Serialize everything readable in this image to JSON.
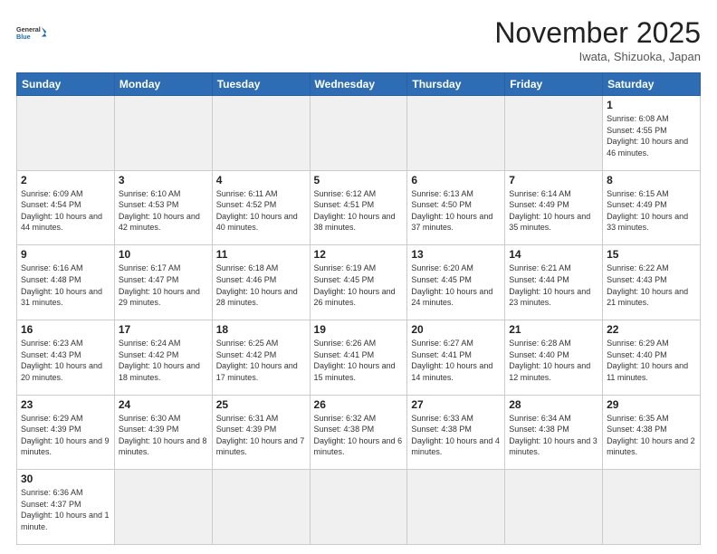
{
  "header": {
    "logo_general": "General",
    "logo_blue": "Blue",
    "month_title": "November 2025",
    "location": "Iwata, Shizuoka, Japan"
  },
  "days_of_week": [
    "Sunday",
    "Monday",
    "Tuesday",
    "Wednesday",
    "Thursday",
    "Friday",
    "Saturday"
  ],
  "weeks": [
    [
      {
        "day": "",
        "empty": true
      },
      {
        "day": "",
        "empty": true
      },
      {
        "day": "",
        "empty": true
      },
      {
        "day": "",
        "empty": true
      },
      {
        "day": "",
        "empty": true
      },
      {
        "day": "",
        "empty": true
      },
      {
        "day": "1",
        "sunrise": "6:08 AM",
        "sunset": "4:55 PM",
        "daylight": "10 hours and 46 minutes."
      }
    ],
    [
      {
        "day": "2",
        "sunrise": "6:09 AM",
        "sunset": "4:54 PM",
        "daylight": "10 hours and 44 minutes."
      },
      {
        "day": "3",
        "sunrise": "6:10 AM",
        "sunset": "4:53 PM",
        "daylight": "10 hours and 42 minutes."
      },
      {
        "day": "4",
        "sunrise": "6:11 AM",
        "sunset": "4:52 PM",
        "daylight": "10 hours and 40 minutes."
      },
      {
        "day": "5",
        "sunrise": "6:12 AM",
        "sunset": "4:51 PM",
        "daylight": "10 hours and 38 minutes."
      },
      {
        "day": "6",
        "sunrise": "6:13 AM",
        "sunset": "4:50 PM",
        "daylight": "10 hours and 37 minutes."
      },
      {
        "day": "7",
        "sunrise": "6:14 AM",
        "sunset": "4:49 PM",
        "daylight": "10 hours and 35 minutes."
      },
      {
        "day": "8",
        "sunrise": "6:15 AM",
        "sunset": "4:49 PM",
        "daylight": "10 hours and 33 minutes."
      }
    ],
    [
      {
        "day": "9",
        "sunrise": "6:16 AM",
        "sunset": "4:48 PM",
        "daylight": "10 hours and 31 minutes."
      },
      {
        "day": "10",
        "sunrise": "6:17 AM",
        "sunset": "4:47 PM",
        "daylight": "10 hours and 29 minutes."
      },
      {
        "day": "11",
        "sunrise": "6:18 AM",
        "sunset": "4:46 PM",
        "daylight": "10 hours and 28 minutes."
      },
      {
        "day": "12",
        "sunrise": "6:19 AM",
        "sunset": "4:45 PM",
        "daylight": "10 hours and 26 minutes."
      },
      {
        "day": "13",
        "sunrise": "6:20 AM",
        "sunset": "4:45 PM",
        "daylight": "10 hours and 24 minutes."
      },
      {
        "day": "14",
        "sunrise": "6:21 AM",
        "sunset": "4:44 PM",
        "daylight": "10 hours and 23 minutes."
      },
      {
        "day": "15",
        "sunrise": "6:22 AM",
        "sunset": "4:43 PM",
        "daylight": "10 hours and 21 minutes."
      }
    ],
    [
      {
        "day": "16",
        "sunrise": "6:23 AM",
        "sunset": "4:43 PM",
        "daylight": "10 hours and 20 minutes."
      },
      {
        "day": "17",
        "sunrise": "6:24 AM",
        "sunset": "4:42 PM",
        "daylight": "10 hours and 18 minutes."
      },
      {
        "day": "18",
        "sunrise": "6:25 AM",
        "sunset": "4:42 PM",
        "daylight": "10 hours and 17 minutes."
      },
      {
        "day": "19",
        "sunrise": "6:26 AM",
        "sunset": "4:41 PM",
        "daylight": "10 hours and 15 minutes."
      },
      {
        "day": "20",
        "sunrise": "6:27 AM",
        "sunset": "4:41 PM",
        "daylight": "10 hours and 14 minutes."
      },
      {
        "day": "21",
        "sunrise": "6:28 AM",
        "sunset": "4:40 PM",
        "daylight": "10 hours and 12 minutes."
      },
      {
        "day": "22",
        "sunrise": "6:29 AM",
        "sunset": "4:40 PM",
        "daylight": "10 hours and 11 minutes."
      }
    ],
    [
      {
        "day": "23",
        "sunrise": "6:29 AM",
        "sunset": "4:39 PM",
        "daylight": "10 hours and 9 minutes."
      },
      {
        "day": "24",
        "sunrise": "6:30 AM",
        "sunset": "4:39 PM",
        "daylight": "10 hours and 8 minutes."
      },
      {
        "day": "25",
        "sunrise": "6:31 AM",
        "sunset": "4:39 PM",
        "daylight": "10 hours and 7 minutes."
      },
      {
        "day": "26",
        "sunrise": "6:32 AM",
        "sunset": "4:38 PM",
        "daylight": "10 hours and 6 minutes."
      },
      {
        "day": "27",
        "sunrise": "6:33 AM",
        "sunset": "4:38 PM",
        "daylight": "10 hours and 4 minutes."
      },
      {
        "day": "28",
        "sunrise": "6:34 AM",
        "sunset": "4:38 PM",
        "daylight": "10 hours and 3 minutes."
      },
      {
        "day": "29",
        "sunrise": "6:35 AM",
        "sunset": "4:38 PM",
        "daylight": "10 hours and 2 minutes."
      }
    ],
    [
      {
        "day": "30",
        "sunrise": "6:36 AM",
        "sunset": "4:37 PM",
        "daylight": "10 hours and 1 minute."
      },
      {
        "day": "",
        "empty": true
      },
      {
        "day": "",
        "empty": true
      },
      {
        "day": "",
        "empty": true
      },
      {
        "day": "",
        "empty": true
      },
      {
        "day": "",
        "empty": true
      },
      {
        "day": "",
        "empty": true
      }
    ]
  ]
}
